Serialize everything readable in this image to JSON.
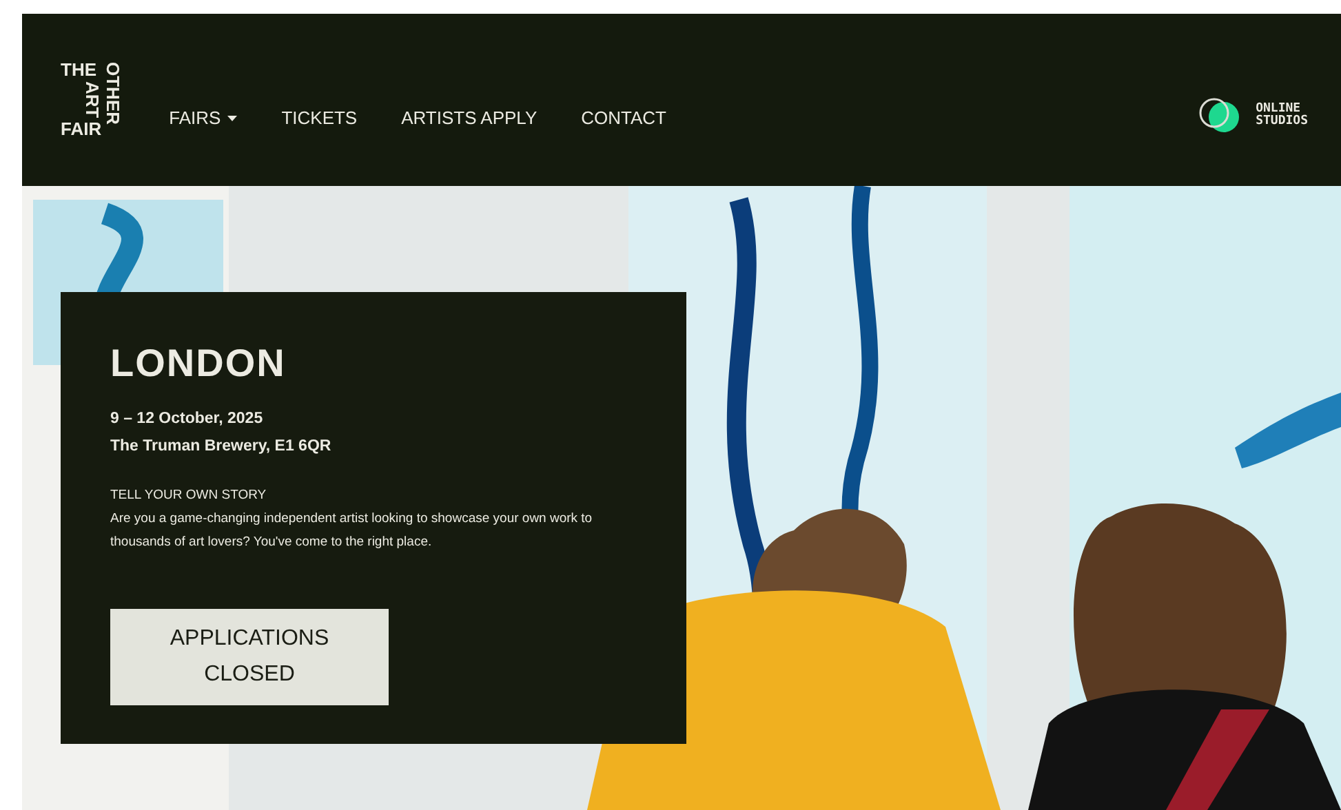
{
  "header": {
    "logo": [
      "THE",
      "OTHER",
      "ART",
      "FAIR"
    ],
    "nav": [
      {
        "label": "FAIRS",
        "dropdown": true
      },
      {
        "label": "TICKETS",
        "dropdown": false
      },
      {
        "label": "ARTISTS APPLY",
        "dropdown": false
      },
      {
        "label": "CONTACT",
        "dropdown": false
      }
    ],
    "online_studios": [
      "ONLINE",
      "STUDIOS"
    ]
  },
  "hero": {
    "card": {
      "title": "LONDON",
      "dates": "9 – 12 October, 2025",
      "venue": "The Truman Brewery, E1 6QR",
      "tagline": "TELL YOUR OWN STORY",
      "body": "Are you a game-changing independent artist looking to showcase your own work to thousands of art lovers? You've come to the right place.",
      "button": "APPLICATIONS CLOSED"
    }
  }
}
